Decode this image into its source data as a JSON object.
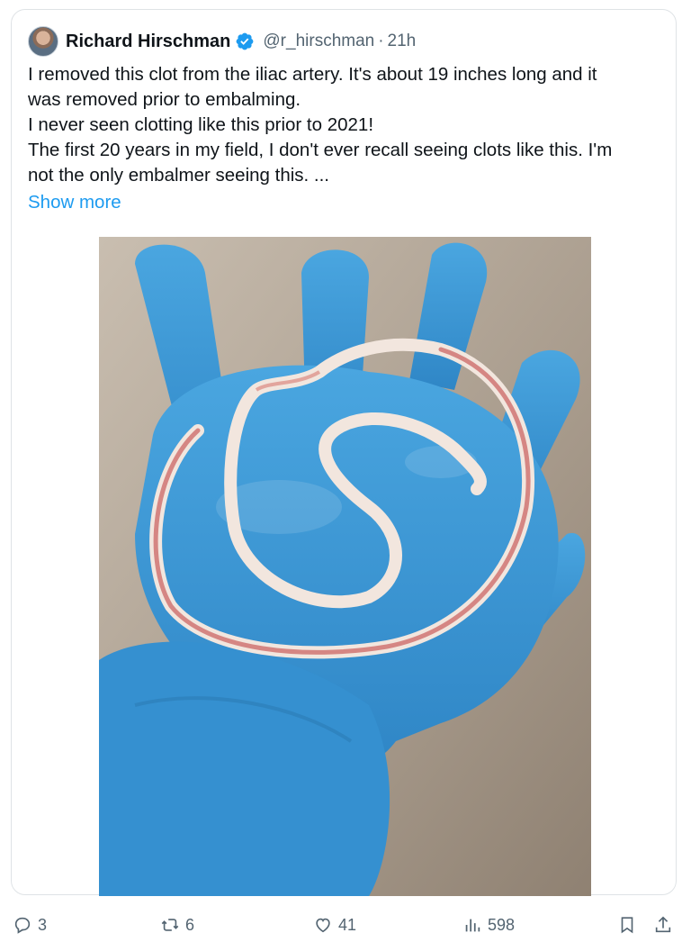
{
  "tweet": {
    "author_name": "Richard Hirschman",
    "handle": "@r_hirschman",
    "separator": "·",
    "time": "21h",
    "lines": [
      "I removed this clot from the iliac artery. It's about 19 inches long and it",
      "was removed prior to embalming.",
      "I never seen clotting like this prior to 2021!",
      "The first 20 years in my field, I don't ever recall seeing clots like this. I'm",
      "not the only embalmer seeing this. ..."
    ],
    "show_more": "Show more"
  },
  "actions": {
    "replies": "3",
    "reposts": "6",
    "likes": "41",
    "views": "598"
  },
  "colors": {
    "link": "#1d9bf0",
    "secondary_text": "#536471",
    "verified": "#1d9bf0",
    "glove": "#3f9ad6"
  },
  "icons": [
    "verified-badge-icon",
    "reply-icon",
    "repost-icon",
    "like-icon",
    "views-icon",
    "bookmark-icon",
    "share-icon"
  ]
}
